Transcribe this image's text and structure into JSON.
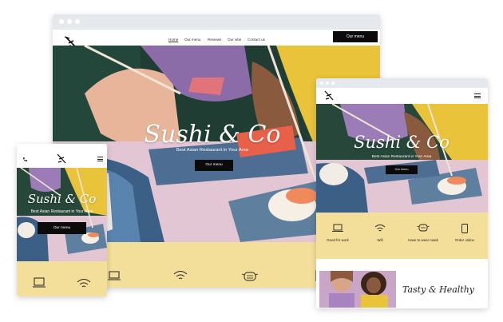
{
  "desktop": {
    "nav": {
      "links": [
        "Home",
        "Our menu",
        "Reviews",
        "Our vibe",
        "Contact us"
      ],
      "cta": "Our menu"
    },
    "hero": {
      "title": "Sushi & Co",
      "subtitle": "Best Asian Restaurant in Your Area",
      "button": "Our menu"
    }
  },
  "tablet": {
    "hero": {
      "title": "Sushi & Co",
      "subtitle": "Best Asian Restaurant in Your Area",
      "button": "Our menu"
    },
    "features": [
      {
        "label": "Good for work",
        "icon": "laptop-icon"
      },
      {
        "label": "Wifi",
        "icon": "wifi-icon"
      },
      {
        "label": "Have to wear mask",
        "icon": "mask-icon"
      },
      {
        "label": "Order online",
        "icon": "phone-order-icon"
      }
    ],
    "promo": {
      "title": "Tasty & Healthy"
    }
  },
  "mobile": {
    "hero": {
      "title": "Sushi & Co",
      "subtitle": "Best Asian Restaurant in Your Area",
      "button": "Our menu"
    }
  },
  "colors": {
    "feature_band": "#f4df9a",
    "accent_black": "#0b0b0b",
    "chrome_bar": "#e5e8ec"
  }
}
